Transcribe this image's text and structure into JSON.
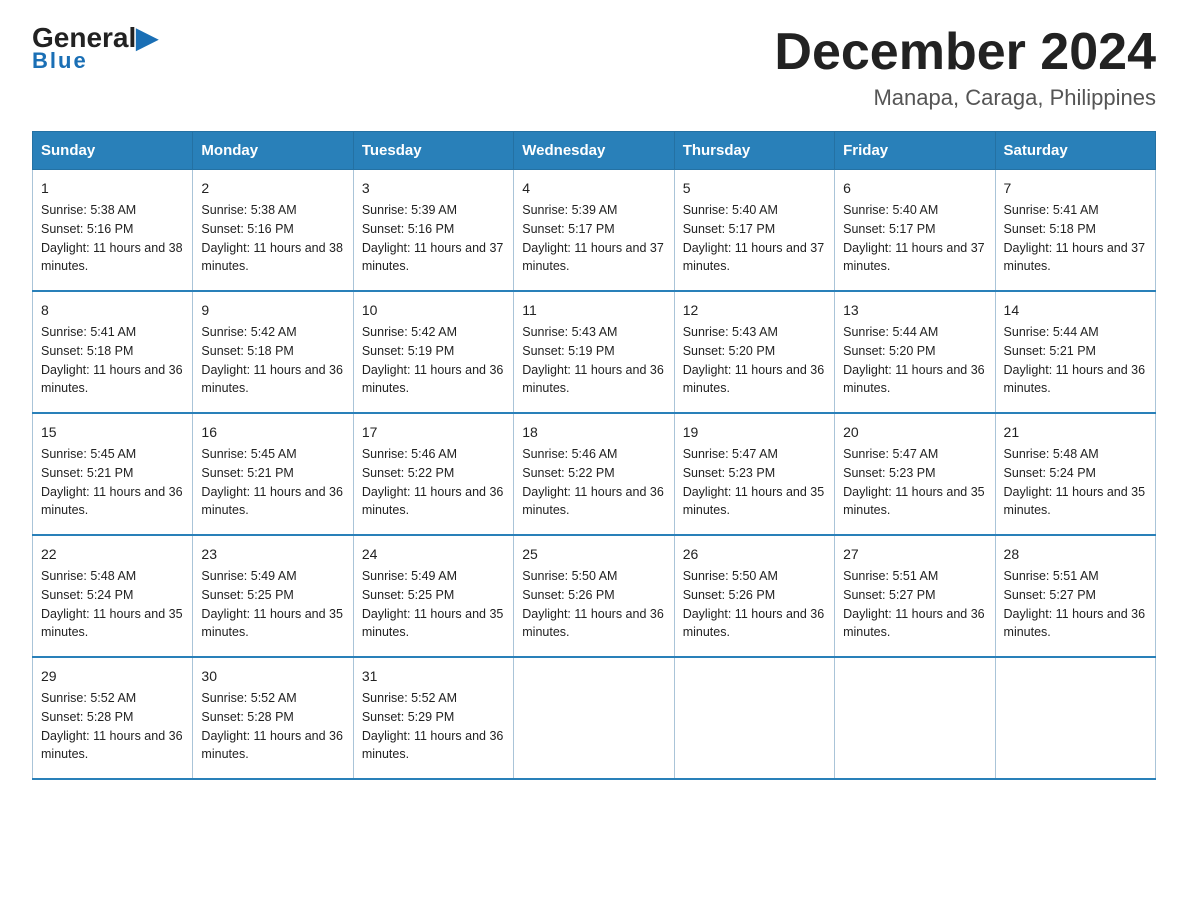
{
  "header": {
    "logo_general": "General",
    "logo_blue": "Blue",
    "month_title": "December 2024",
    "location": "Manapa, Caraga, Philippines"
  },
  "days_of_week": [
    "Sunday",
    "Monday",
    "Tuesday",
    "Wednesday",
    "Thursday",
    "Friday",
    "Saturday"
  ],
  "weeks": [
    [
      {
        "day": "1",
        "sunrise": "5:38 AM",
        "sunset": "5:16 PM",
        "daylight": "11 hours and 38 minutes."
      },
      {
        "day": "2",
        "sunrise": "5:38 AM",
        "sunset": "5:16 PM",
        "daylight": "11 hours and 38 minutes."
      },
      {
        "day": "3",
        "sunrise": "5:39 AM",
        "sunset": "5:16 PM",
        "daylight": "11 hours and 37 minutes."
      },
      {
        "day": "4",
        "sunrise": "5:39 AM",
        "sunset": "5:17 PM",
        "daylight": "11 hours and 37 minutes."
      },
      {
        "day": "5",
        "sunrise": "5:40 AM",
        "sunset": "5:17 PM",
        "daylight": "11 hours and 37 minutes."
      },
      {
        "day": "6",
        "sunrise": "5:40 AM",
        "sunset": "5:17 PM",
        "daylight": "11 hours and 37 minutes."
      },
      {
        "day": "7",
        "sunrise": "5:41 AM",
        "sunset": "5:18 PM",
        "daylight": "11 hours and 37 minutes."
      }
    ],
    [
      {
        "day": "8",
        "sunrise": "5:41 AM",
        "sunset": "5:18 PM",
        "daylight": "11 hours and 36 minutes."
      },
      {
        "day": "9",
        "sunrise": "5:42 AM",
        "sunset": "5:18 PM",
        "daylight": "11 hours and 36 minutes."
      },
      {
        "day": "10",
        "sunrise": "5:42 AM",
        "sunset": "5:19 PM",
        "daylight": "11 hours and 36 minutes."
      },
      {
        "day": "11",
        "sunrise": "5:43 AM",
        "sunset": "5:19 PM",
        "daylight": "11 hours and 36 minutes."
      },
      {
        "day": "12",
        "sunrise": "5:43 AM",
        "sunset": "5:20 PM",
        "daylight": "11 hours and 36 minutes."
      },
      {
        "day": "13",
        "sunrise": "5:44 AM",
        "sunset": "5:20 PM",
        "daylight": "11 hours and 36 minutes."
      },
      {
        "day": "14",
        "sunrise": "5:44 AM",
        "sunset": "5:21 PM",
        "daylight": "11 hours and 36 minutes."
      }
    ],
    [
      {
        "day": "15",
        "sunrise": "5:45 AM",
        "sunset": "5:21 PM",
        "daylight": "11 hours and 36 minutes."
      },
      {
        "day": "16",
        "sunrise": "5:45 AM",
        "sunset": "5:21 PM",
        "daylight": "11 hours and 36 minutes."
      },
      {
        "day": "17",
        "sunrise": "5:46 AM",
        "sunset": "5:22 PM",
        "daylight": "11 hours and 36 minutes."
      },
      {
        "day": "18",
        "sunrise": "5:46 AM",
        "sunset": "5:22 PM",
        "daylight": "11 hours and 36 minutes."
      },
      {
        "day": "19",
        "sunrise": "5:47 AM",
        "sunset": "5:23 PM",
        "daylight": "11 hours and 35 minutes."
      },
      {
        "day": "20",
        "sunrise": "5:47 AM",
        "sunset": "5:23 PM",
        "daylight": "11 hours and 35 minutes."
      },
      {
        "day": "21",
        "sunrise": "5:48 AM",
        "sunset": "5:24 PM",
        "daylight": "11 hours and 35 minutes."
      }
    ],
    [
      {
        "day": "22",
        "sunrise": "5:48 AM",
        "sunset": "5:24 PM",
        "daylight": "11 hours and 35 minutes."
      },
      {
        "day": "23",
        "sunrise": "5:49 AM",
        "sunset": "5:25 PM",
        "daylight": "11 hours and 35 minutes."
      },
      {
        "day": "24",
        "sunrise": "5:49 AM",
        "sunset": "5:25 PM",
        "daylight": "11 hours and 35 minutes."
      },
      {
        "day": "25",
        "sunrise": "5:50 AM",
        "sunset": "5:26 PM",
        "daylight": "11 hours and 36 minutes."
      },
      {
        "day": "26",
        "sunrise": "5:50 AM",
        "sunset": "5:26 PM",
        "daylight": "11 hours and 36 minutes."
      },
      {
        "day": "27",
        "sunrise": "5:51 AM",
        "sunset": "5:27 PM",
        "daylight": "11 hours and 36 minutes."
      },
      {
        "day": "28",
        "sunrise": "5:51 AM",
        "sunset": "5:27 PM",
        "daylight": "11 hours and 36 minutes."
      }
    ],
    [
      {
        "day": "29",
        "sunrise": "5:52 AM",
        "sunset": "5:28 PM",
        "daylight": "11 hours and 36 minutes."
      },
      {
        "day": "30",
        "sunrise": "5:52 AM",
        "sunset": "5:28 PM",
        "daylight": "11 hours and 36 minutes."
      },
      {
        "day": "31",
        "sunrise": "5:52 AM",
        "sunset": "5:29 PM",
        "daylight": "11 hours and 36 minutes."
      },
      null,
      null,
      null,
      null
    ]
  ]
}
